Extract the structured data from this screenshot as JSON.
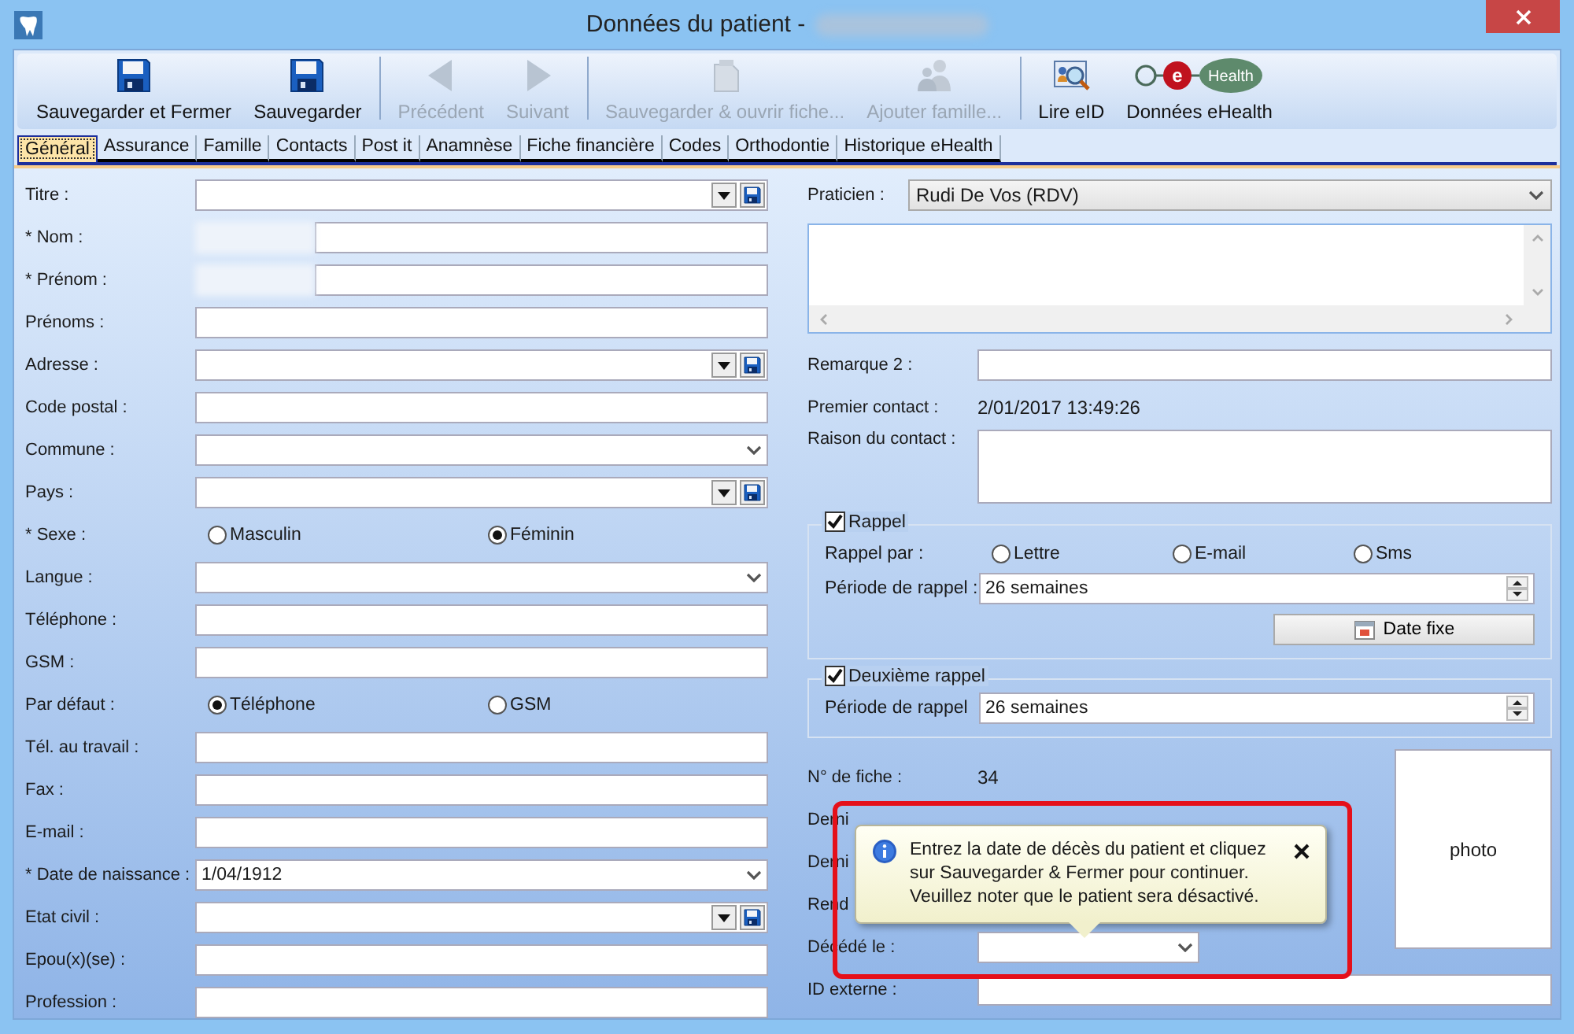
{
  "window": {
    "title": "Données du patient -",
    "title_redacted": true
  },
  "toolbar": [
    {
      "label": "Sauvegarder et Fermer",
      "kind": "save",
      "disabled": false
    },
    {
      "label": "Sauvegarder",
      "kind": "save",
      "disabled": false
    },
    {
      "kind": "separator"
    },
    {
      "label": "Précédent",
      "kind": "prev",
      "disabled": true
    },
    {
      "label": "Suivant",
      "kind": "next",
      "disabled": true
    },
    {
      "kind": "separator"
    },
    {
      "label": "Sauvegarder & ouvrir fiche...",
      "kind": "doc",
      "disabled": true
    },
    {
      "label": "Ajouter famille...",
      "kind": "people",
      "disabled": true
    },
    {
      "kind": "separator"
    },
    {
      "label": "Lire eID",
      "kind": "eid",
      "disabled": false
    },
    {
      "label": "Données eHealth",
      "kind": "ehealth",
      "disabled": false,
      "logo_letter": "e",
      "logo_word": "Health"
    }
  ],
  "tabs": [
    {
      "label": "Général",
      "selected": true
    },
    {
      "label": "Assurance",
      "selected": false
    },
    {
      "label": "Famille",
      "selected": false
    },
    {
      "label": "Contacts",
      "selected": false
    },
    {
      "label": "Post it",
      "selected": false
    },
    {
      "label": "Anamnèse",
      "selected": false
    },
    {
      "label": "Fiche financière",
      "selected": false
    },
    {
      "label": "Codes",
      "selected": false
    },
    {
      "label": "Orthodontie",
      "selected": false
    },
    {
      "label": "Historique eHealth",
      "selected": false
    }
  ],
  "left_form": [
    {
      "label": "Titre :",
      "kind": "combo-save"
    },
    {
      "label": "* Nom :",
      "kind": "redacted"
    },
    {
      "label": "* Prénom :",
      "kind": "redacted"
    },
    {
      "label": "Prénoms :",
      "kind": "text"
    },
    {
      "label": "Adresse :",
      "kind": "combo-save"
    },
    {
      "label": "Code postal :",
      "kind": "text"
    },
    {
      "label": "Commune :",
      "kind": "combo"
    },
    {
      "label": "Pays :",
      "kind": "combo-save"
    },
    {
      "label": "* Sexe :",
      "kind": "radio",
      "options": [
        {
          "label": "Masculin",
          "selected": false
        },
        {
          "label": "Féminin",
          "selected": true
        }
      ]
    },
    {
      "label": "Langue :",
      "kind": "combo"
    },
    {
      "label": "Téléphone :",
      "kind": "text"
    },
    {
      "label": "GSM :",
      "kind": "text"
    },
    {
      "label": "Par défaut :",
      "kind": "radio",
      "options": [
        {
          "label": "Téléphone",
          "selected": true
        },
        {
          "label": "GSM",
          "selected": false
        }
      ]
    },
    {
      "label": "Tél. au travail :",
      "kind": "text"
    },
    {
      "label": "Fax :",
      "kind": "text"
    },
    {
      "label": "E-mail :",
      "kind": "text"
    },
    {
      "label": "* Date de naissance :",
      "kind": "combo",
      "value": "1/04/1912"
    },
    {
      "label": "Etat civil :",
      "kind": "combo-save"
    },
    {
      "label": "Epou(x)(se) :",
      "kind": "text"
    },
    {
      "label": "Profession :",
      "kind": "text"
    }
  ],
  "right_form": {
    "praticien": {
      "label": "Praticien :",
      "value": "Rudi De Vos (RDV)"
    },
    "remarque_2": {
      "label": "Remarque 2 :"
    },
    "premier_contact": {
      "label": "Premier contact :",
      "value": "2/01/2017 13:49:26"
    },
    "raison_du_contact": {
      "label": "Raison du contact :"
    },
    "rappel": {
      "label": "Rappel",
      "checked": true,
      "par_label": "Rappel par :",
      "options": [
        {
          "label": "Lettre",
          "selected": false
        },
        {
          "label": "E-mail",
          "selected": false
        },
        {
          "label": "Sms",
          "selected": false
        }
      ],
      "periode_label": "Période de rappel :",
      "periode": "26 semaines",
      "button": "Date fixe"
    },
    "deuxieme_rappel": {
      "label": "Deuxième rappel",
      "checked": true,
      "periode_label": "Période de rappel",
      "periode": "26 semaines"
    },
    "fiche": {
      "label": "N° de fiche :",
      "value": "34"
    },
    "covered_labels": [
      "Derni",
      "Derni",
      "Rend"
    ],
    "decede": {
      "label": "Décédé le :"
    },
    "photo": "photo",
    "id_externe": {
      "label": "ID externe :"
    }
  },
  "tooltip": {
    "lines": [
      "Entrez la date de décès du patient et cliquez",
      "sur Sauvegarder & Fermer pour continuer.",
      "Veuillez noter que le patient sera désactivé."
    ],
    "highlighted": true
  }
}
